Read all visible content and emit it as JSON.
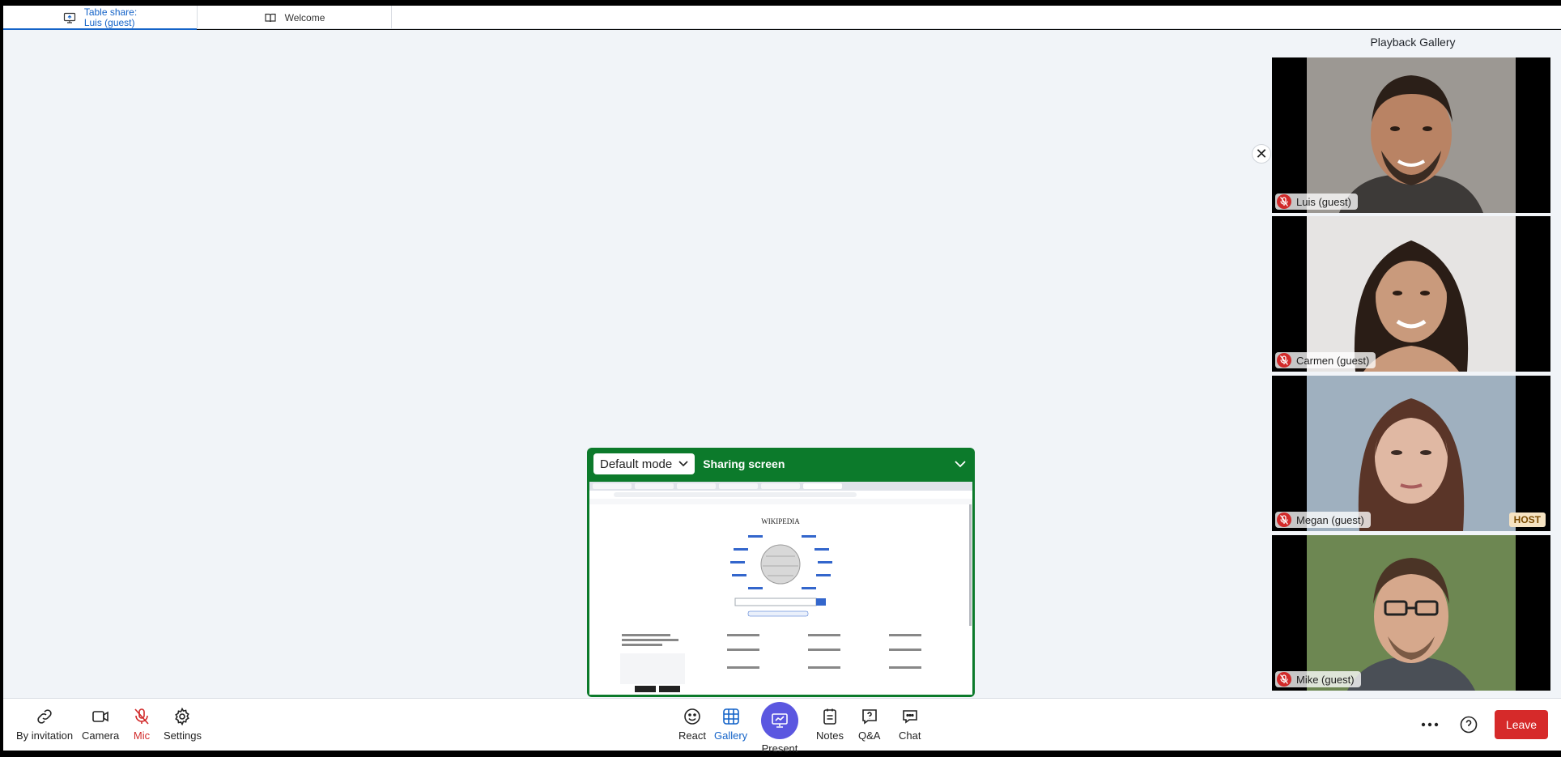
{
  "tabs": [
    {
      "label_line1": "Table share:",
      "label_line2": "Luis (guest)",
      "icon": "screen-share-icon",
      "active": true
    },
    {
      "label": "Welcome",
      "icon": "book-icon",
      "active": false
    }
  ],
  "gallery": {
    "title": "Playback Gallery",
    "participants": [
      {
        "name": "Luis (guest)",
        "muted": true
      },
      {
        "name": "Carmen (guest)",
        "muted": true
      },
      {
        "name": "Megan (guest)",
        "muted": true,
        "badge": "HOST"
      },
      {
        "name": "Mike (guest)",
        "muted": true
      }
    ]
  },
  "share": {
    "mode_label": "Default mode",
    "status": "Sharing screen"
  },
  "toolbar": {
    "left": [
      {
        "label": "By invitation",
        "icon": "link-icon"
      },
      {
        "label": "Camera",
        "icon": "camera-icon"
      },
      {
        "label": "Mic",
        "icon": "mic-off-icon"
      },
      {
        "label": "Settings",
        "icon": "gear-icon"
      }
    ],
    "center": [
      {
        "label": "React",
        "icon": "smiley-icon"
      },
      {
        "label": "Gallery",
        "icon": "grid-icon"
      },
      {
        "label": "Present",
        "icon": "present-icon"
      },
      {
        "label": "Notes",
        "icon": "notes-icon"
      },
      {
        "label": "Q&A",
        "icon": "qa-icon"
      },
      {
        "label": "Chat",
        "icon": "chat-icon"
      }
    ],
    "leave_label": "Leave"
  },
  "colors": {
    "accent": "#1463c8",
    "share_green": "#0c7a2b",
    "leave_red": "#d62a2a",
    "present_purple": "#5b57e0"
  }
}
